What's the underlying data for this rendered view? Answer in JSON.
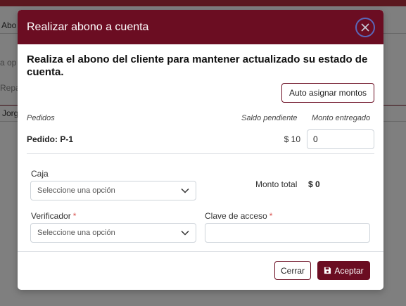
{
  "background": {
    "tab_text": "Abo",
    "search_placeholder": "a op",
    "column_text": "Repa",
    "row_text": "Jorg"
  },
  "modal": {
    "title": "Realizar abono a cuenta",
    "close_icon": "close-icon",
    "lead": "Realiza el abono del cliente para mantener actualizado su estado de cuenta.",
    "auto_assign_label": "Auto asignar montos",
    "columns": {
      "orders": "Pedidos",
      "pending": "Saldo pendiente",
      "delivered": "Monto entregado"
    },
    "order": {
      "label": "Pedido: P-1",
      "pending": "$ 10",
      "delivered": "0"
    },
    "caja": {
      "label": "Caja",
      "value": "Seleccione una opción"
    },
    "total": {
      "label": "Monto total",
      "value": "$ 0"
    },
    "verificador": {
      "label": "Verificador",
      "required_mark": "*",
      "value": "Seleccione una opción"
    },
    "clave": {
      "label": "Clave de acceso",
      "required_mark": "*",
      "value": ""
    },
    "cancel_label": "Cerrar",
    "accept_label": "Aceptar",
    "accept_icon": "save-icon"
  },
  "colors": {
    "brand": "#6b0d22",
    "top_bar": "#b7313f",
    "required": "#d9534f"
  }
}
